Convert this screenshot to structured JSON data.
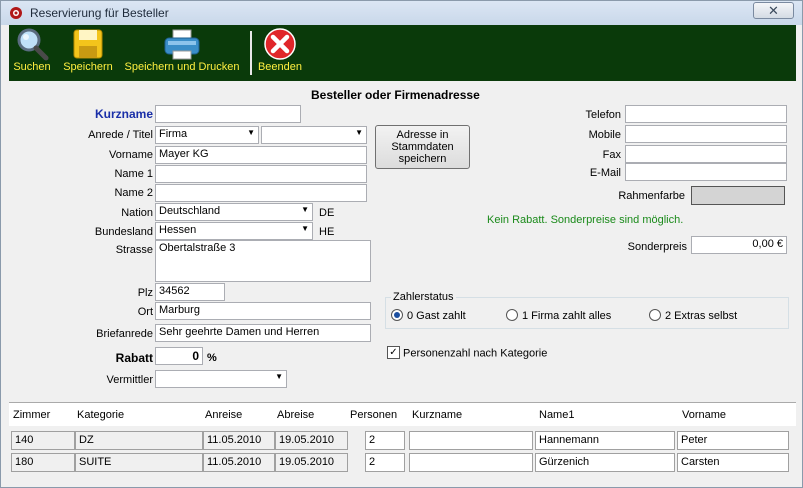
{
  "window": {
    "title": "Reservierung für Besteller",
    "close_glyph": "✕"
  },
  "toolbar": [
    {
      "id": "search",
      "label": "Suchen",
      "icon": "magnifier-icon"
    },
    {
      "id": "save",
      "label": "Speichern",
      "icon": "floppy-disk-icon"
    },
    {
      "id": "save_print",
      "label": "Speichern und Drucken",
      "icon": "printer-icon"
    },
    {
      "id": "exit",
      "label": "Beenden",
      "icon": "red-x-icon"
    }
  ],
  "section_title": "Besteller oder Firmenadresse",
  "left_form": {
    "kurzname_label": "Kurzname",
    "kurzname_value": "",
    "anrede_label": "Anrede / Titel",
    "anrede_value": "Firma",
    "titel_value": "",
    "vorname_label": "Vorname",
    "vorname_value": "Mayer KG",
    "name1_label": "Name 1",
    "name1_value": "",
    "name2_label": "Name 2",
    "name2_value": "",
    "nation_label": "Nation",
    "nation_value": "Deutschland",
    "nation_code": "DE",
    "bundesland_label": "Bundesland",
    "bundesland_value": "Hessen",
    "bundesland_code": "HE",
    "strasse_label": "Strasse",
    "strasse_value": "Obertalstraße 3",
    "plz_label": "Plz",
    "plz_value": "34562",
    "ort_label": "Ort",
    "ort_value": "Marburg",
    "briefanrede_label": "Briefanrede",
    "briefanrede_value": "Sehr geehrte Damen und Herren",
    "rabatt_label": "Rabatt",
    "rabatt_value": "0",
    "rabatt_unit": "%",
    "vermittler_label": "Vermittler",
    "vermittler_value": ""
  },
  "save_address_button": "Adresse in Stammdaten speichern",
  "right_form": {
    "telefon_label": "Telefon",
    "telefon_value": "",
    "mobile_label": "Mobile",
    "mobile_value": "",
    "fax_label": "Fax",
    "fax_value": "",
    "email_label": "E-Mail",
    "email_value": "",
    "rahmenfarbe_label": "Rahmenfarbe",
    "discount_note": "Kein Rabatt. Sonderpreise sind möglich.",
    "sonderpreis_label": "Sonderpreis",
    "sonderpreis_value": "0,00 €"
  },
  "zahlerstatus": {
    "title": "Zahlerstatus",
    "options": [
      "0 Gast zahlt",
      "1 Firma zahlt alles",
      "2 Extras selbst"
    ],
    "selected_index": 0
  },
  "personenzahl": {
    "label": "Personenzahl nach Kategorie",
    "checked": true
  },
  "grid": {
    "headers": [
      "Zimmer",
      "Kategorie",
      "Anreise",
      "Abreise",
      "Personen",
      "Kurzname",
      "Name1",
      "Vorname"
    ],
    "rows": [
      {
        "zimmer": "140",
        "kategorie": "DZ",
        "anreise": "11.05.2010",
        "abreise": "19.05.2010",
        "personen": "2",
        "kurzname": "",
        "name1": "Hannemann",
        "vorname": "Peter"
      },
      {
        "zimmer": "180",
        "kategorie": "SUITE",
        "anreise": "11.05.2010",
        "abreise": "19.05.2010",
        "personen": "2",
        "kurzname": "",
        "name1": "Gürzenich",
        "vorname": "Carsten"
      }
    ]
  },
  "colors": {
    "toolbar_bg": "#0a3a0a",
    "toolbar_text": "#ffef40",
    "kurzname_label": "#1a2fa8",
    "note_green": "#1a8a1a"
  }
}
